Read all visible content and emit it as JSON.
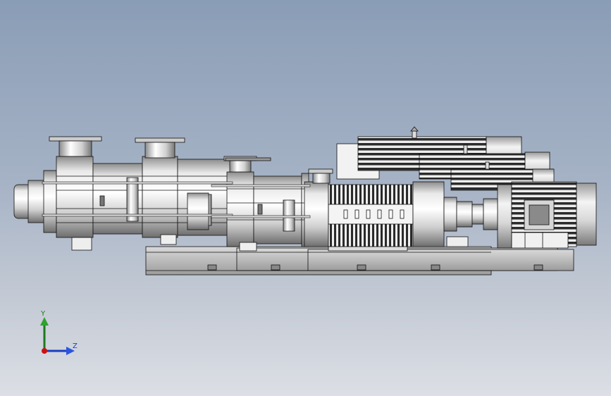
{
  "viewport": {
    "background_top": "#8a9db6",
    "background_bottom": "#dcdfe5"
  },
  "model": {
    "subject": "multistage-pump-assembly-icon",
    "metal_light": "#f2f2f2",
    "metal_mid": "#bdbdbd",
    "metal_dark": "#555555",
    "edge_color": "#111111"
  },
  "triad": {
    "y_label": "Y",
    "z_label": "Z",
    "y_color": "#1c7a1c",
    "z_color": "#1a3fbf",
    "origin_color": "#cc1111"
  }
}
